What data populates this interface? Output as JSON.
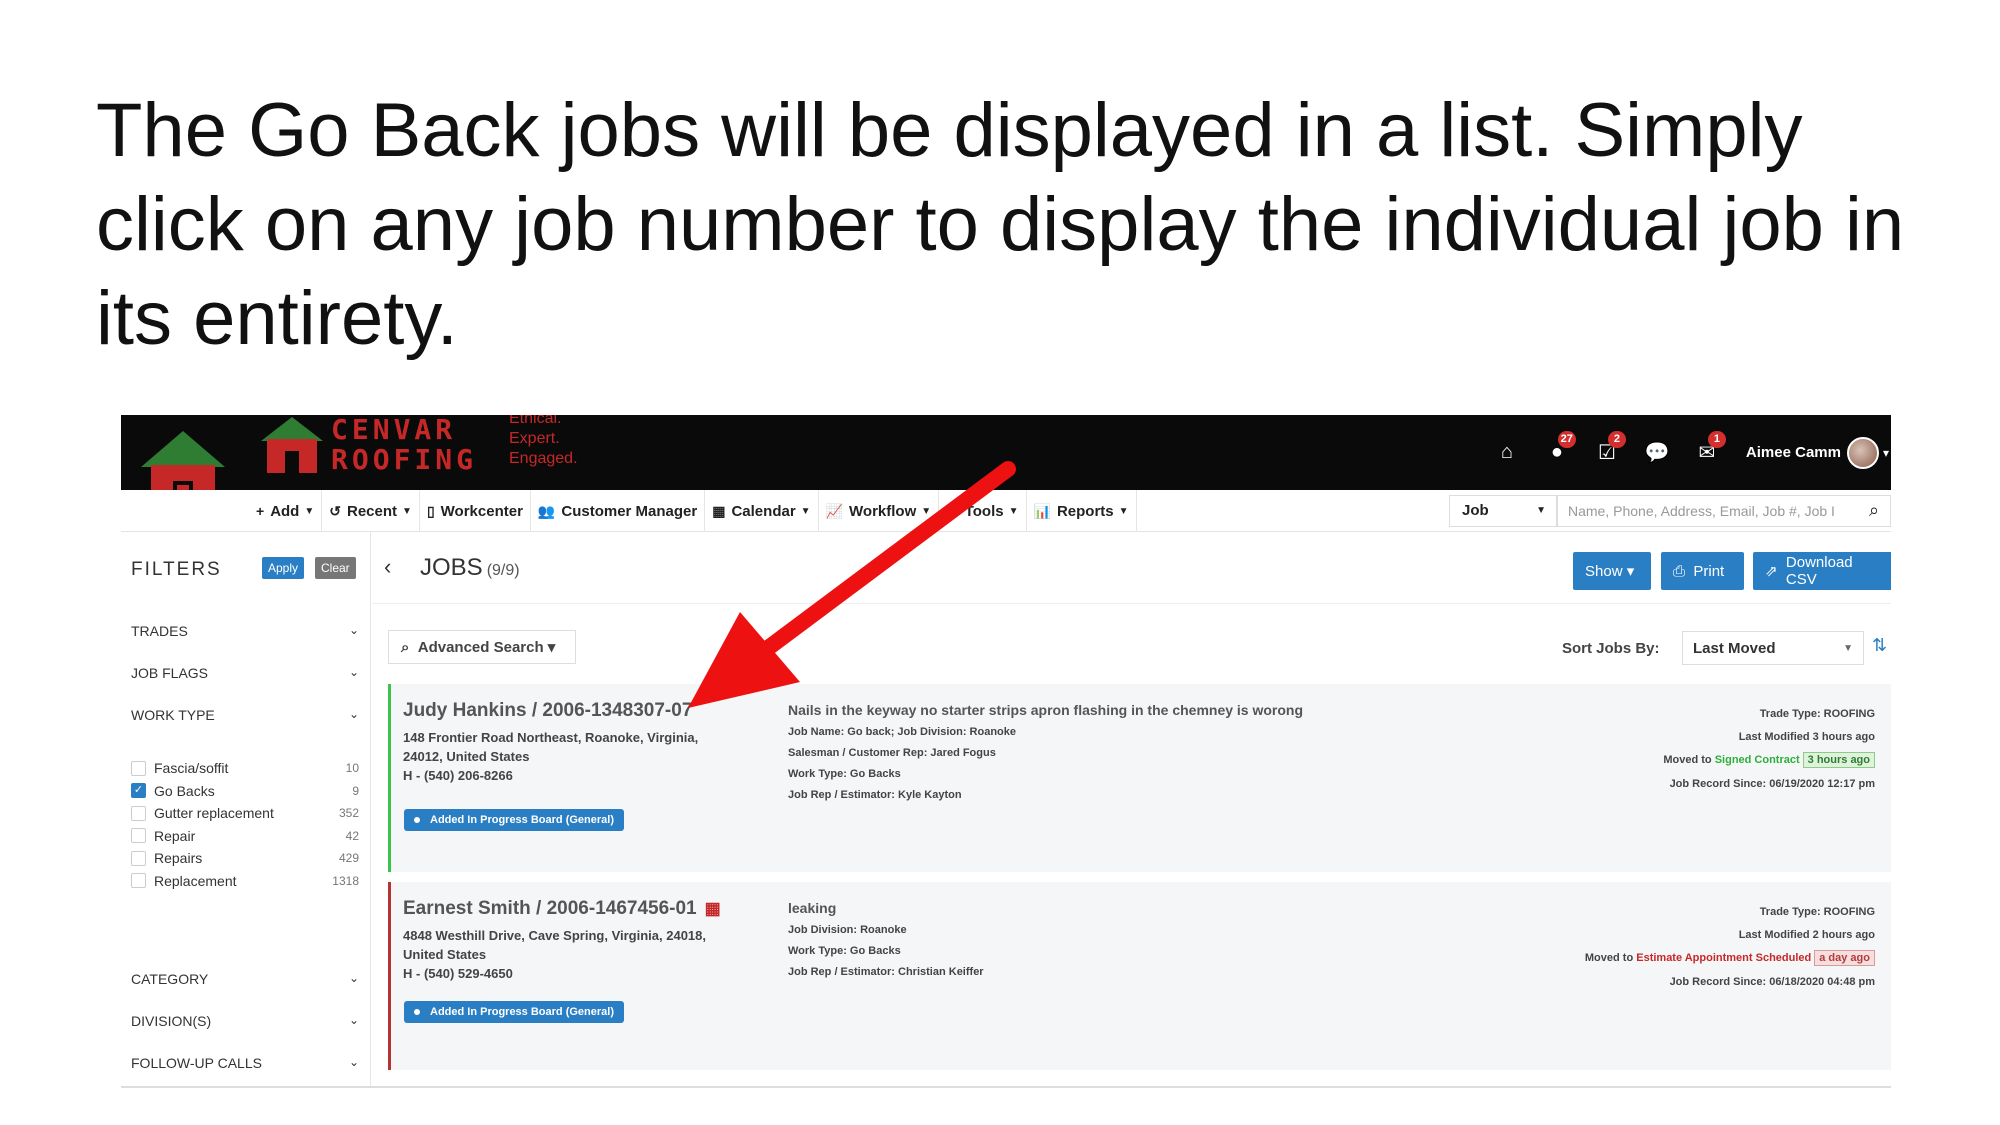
{
  "slide": {
    "title": "The Go Back jobs will be displayed in a list. Simply click on any job number to display the individual job in its entirety."
  },
  "topbar": {
    "logo_text_line1": "CENVAR",
    "logo_text_line2": "ROOFING",
    "tagline_1": "Ethical.",
    "tagline_2": "Expert.",
    "tagline_3": "Engaged.",
    "icons": [
      "home-icon",
      "alert-icon",
      "tasks-icon",
      "chat-icon",
      "mail-icon"
    ],
    "badge_alerts": "27",
    "badge_tasks": "2",
    "badge_mail": "1",
    "user_name": "Aimee Camm"
  },
  "nav": {
    "items": [
      {
        "icon": "+",
        "label": "Add",
        "caret": true
      },
      {
        "icon": "↺",
        "label": "Recent",
        "caret": true
      },
      {
        "icon": "▯",
        "label": "Workcenter",
        "caret": false
      },
      {
        "icon": "👥",
        "label": "Customer Manager",
        "caret": false
      },
      {
        "icon": "▦",
        "label": "Calendar",
        "caret": true
      },
      {
        "icon": "📈",
        "label": "Workflow",
        "caret": true
      },
      {
        "icon": "⚙",
        "label": "Tools",
        "caret": true
      },
      {
        "icon": "📊",
        "label": "Reports",
        "caret": true
      }
    ],
    "search_type": "Job",
    "search_placeholder": "Name, Phone, Address, Email, Job #, Job I"
  },
  "sidebar": {
    "title": "FILTERS",
    "apply": "Apply",
    "clear": "Clear",
    "sections_top": [
      "TRADES",
      "JOB FLAGS",
      "WORK TYPE"
    ],
    "work_types": [
      {
        "label": "Fascia/soffit",
        "count": "10",
        "checked": false
      },
      {
        "label": "Go Backs",
        "count": "9",
        "checked": true
      },
      {
        "label": "Gutter replacement",
        "count": "352",
        "checked": false
      },
      {
        "label": "Repair",
        "count": "42",
        "checked": false
      },
      {
        "label": "Repairs",
        "count": "429",
        "checked": false
      },
      {
        "label": "Replacement",
        "count": "1318",
        "checked": false
      }
    ],
    "sections_bottom": [
      "CATEGORY",
      "DIVISION(S)",
      "FOLLOW-UP CALLS"
    ]
  },
  "main": {
    "title": "JOBS",
    "count": "(9/9)",
    "show_btn": "Show",
    "print_btn": "Print",
    "csv_btn": "Download CSV",
    "adv_search": "Advanced Search",
    "sort_label": "Sort Jobs By:",
    "sort_value": "Last Moved"
  },
  "jobs": [
    {
      "title": "Judy Hankins / 2006-1348307-07",
      "addr": "148 Frontier Road Northeast, Roanoke, Virginia, 24012, United States",
      "phone": "H - (540) 206-8266",
      "tag": "Added In Progress Board (General)",
      "desc": "Nails in the keyway no starter strips apron flashing in the chemney is worong",
      "meta1": "Job Name:  Go back;  Job Division:  Roanoke",
      "meta2": "Salesman / Customer Rep:  Jared Fogus",
      "meta3": "Work Type:  Go Backs",
      "meta4": "Job Rep / Estimator:  Kyle Kayton",
      "trade": "Trade Type: ROOFING",
      "modified": "Last Modified 3 hours ago",
      "moved_prefix": "Moved to ",
      "moved_stage": "Signed Contract",
      "moved_when": "3 hours ago",
      "since": "Job Record Since: 06/19/2020 12:17 pm",
      "bar_color": "#3ac44a"
    },
    {
      "title": "Earnest Smith / 2006-1467456-01",
      "addr": "4848 Westhill Drive, Cave Spring, Virginia, 24018, United States",
      "phone": "H - (540) 529-4650",
      "tag": "Added In Progress Board (General)",
      "desc": "leaking",
      "meta1": "Job Division:  Roanoke",
      "meta2": "Work Type:  Go Backs",
      "meta3": "Job Rep / Estimator:  Christian Keiffer",
      "trade": "Trade Type: ROOFING",
      "modified": "Last Modified 2 hours ago",
      "moved_prefix": "Moved to ",
      "moved_stage": "Estimate Appointment Scheduled",
      "moved_when": "a day ago",
      "since": "Job Record Since: 06/18/2020 04:48 pm",
      "bar_color": "#b43333"
    }
  ]
}
